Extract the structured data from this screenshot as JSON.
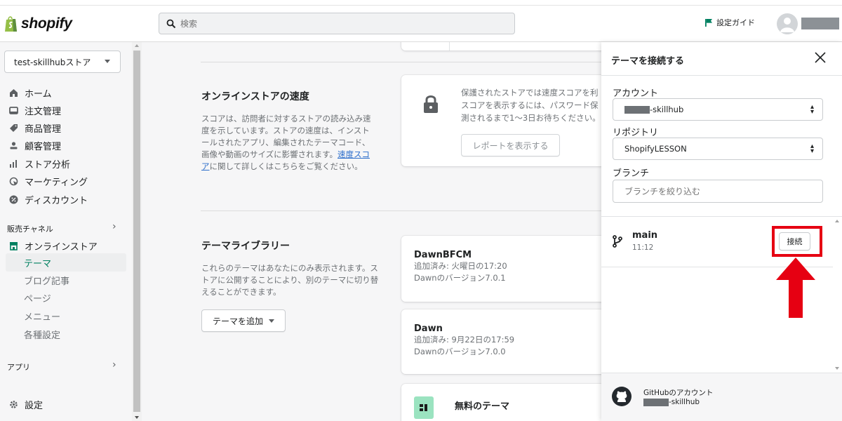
{
  "brand": {
    "name": "shopify",
    "accent": "#008060",
    "highlight": "#e60012"
  },
  "header": {
    "search_placeholder": "検索",
    "setup_guide": "設定ガイド"
  },
  "sidebar": {
    "store": "test-skillhubストア",
    "items": [
      {
        "label": "ホーム",
        "icon": "home-icon"
      },
      {
        "label": "注文管理",
        "icon": "orders-icon"
      },
      {
        "label": "商品管理",
        "icon": "tag-icon"
      },
      {
        "label": "顧客管理",
        "icon": "person-icon"
      },
      {
        "label": "ストア分析",
        "icon": "analytics-icon"
      },
      {
        "label": "マーケティング",
        "icon": "marketing-icon"
      },
      {
        "label": "ディスカウント",
        "icon": "discount-icon"
      }
    ],
    "sales_channels_label": "販売チャネル",
    "online_store": "オンラインストア",
    "online_store_sub": [
      "テーマ",
      "ブログ記事",
      "ページ",
      "メニュー",
      "各種設定"
    ],
    "apps_label": "アプリ",
    "settings": "設定"
  },
  "main": {
    "speed": {
      "title": "オンラインストアの速度",
      "desc_before": "スコアは、訪問者に対するストアの読み込み速度を示しています。ストアの速度は、インストールされたアプリ、編集されたテーマコード、画像や動画のサイズに影響されます。",
      "link": "速度スコア",
      "desc_after": "に関して詳しくはこちらをご覧ください。",
      "card_line1": "保護されたストアでは速度スコアを利",
      "card_line2": "スコアを表示するには、パスワード保",
      "card_line3": "測されるまで1〜3日お待ちください。",
      "report_button": "レポートを表示する"
    },
    "library": {
      "title": "テーマライブラリー",
      "desc": "これらのテーマはあなたにのみ表示されます。ストアに公開することにより、別のテーマに切り替えることができます。",
      "add_button": "テーマを追加",
      "themes": [
        {
          "name": "DawnBFCM",
          "added": "追加済み: 火曜日の17:20",
          "version": "Dawnのバージョン7.0.1"
        },
        {
          "name": "Dawn",
          "added": "追加済み: 9月22日の17:59",
          "version": "Dawnのバージョン7.0.0"
        }
      ],
      "free_themes_title": "無料のテーマ"
    }
  },
  "panel": {
    "title": "テーマを接続する",
    "account_label": "アカウント",
    "account_value": "-skillhub",
    "repo_label": "リポジトリ",
    "repo_value": "ShopifyLESSON",
    "branch_label": "ブランチ",
    "branch_placeholder": "ブランチを絞り込む",
    "branch": {
      "name": "main",
      "time": "11:12"
    },
    "connect_button": "接続",
    "footer_title": "GitHubのアカウント",
    "footer_account": "-skillhub"
  }
}
